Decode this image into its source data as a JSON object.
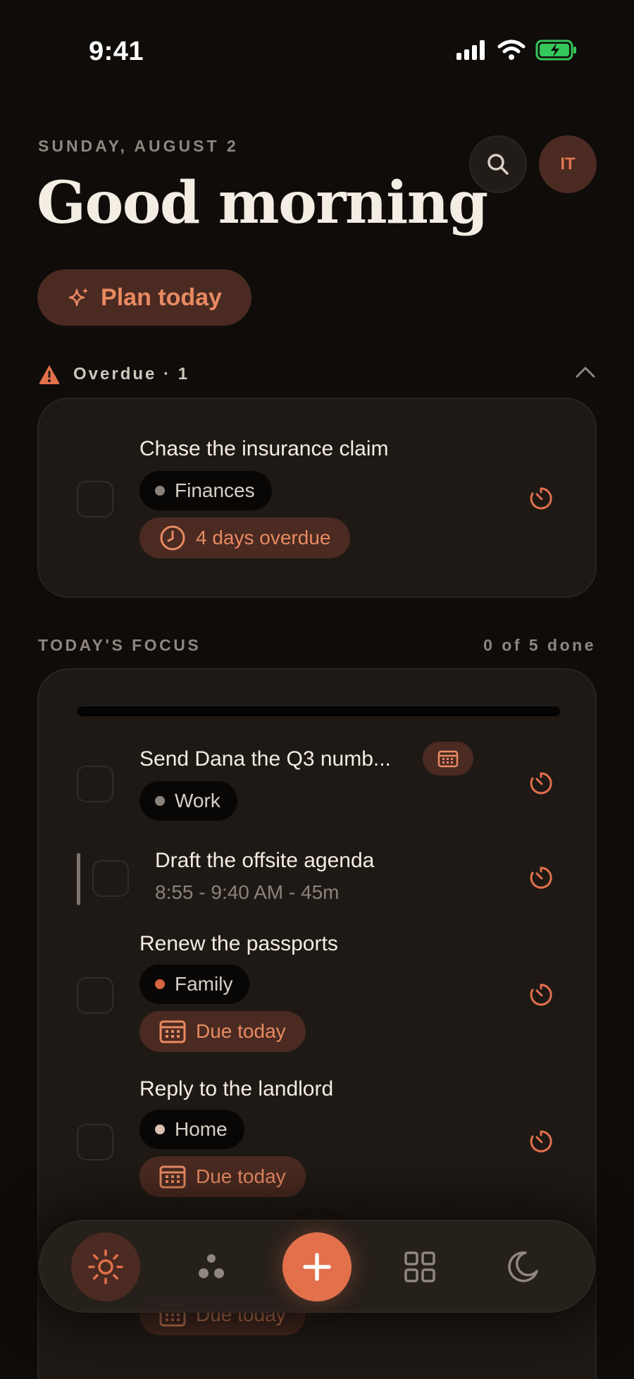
{
  "status": {
    "time": "9:41"
  },
  "header": {
    "date": "SUNDAY, AUGUST 2",
    "greeting": "Good morning",
    "avatar_initials": "IT"
  },
  "plan_button": {
    "label": "Plan today"
  },
  "overdue": {
    "label": "Overdue · 1",
    "task": {
      "title": "Chase the insurance claim",
      "tag": "Finances",
      "status": "4 days overdue"
    }
  },
  "focus": {
    "label": "TODAY'S FOCUS",
    "progress_text": "0 of 5 done",
    "progress_fraction": 0,
    "tasks": [
      {
        "title": "Send Dana the Q3 numb...",
        "tag": "Work"
      },
      {
        "title": "Draft the offsite agenda",
        "time": "8:55 - 9:40 AM  -  45m"
      },
      {
        "title": "Renew the passports",
        "tag": "Family",
        "status": "Due today"
      },
      {
        "title": "Reply to the landlord",
        "tag": "Home",
        "status": "Due today"
      },
      {
        "status": "Due today"
      }
    ]
  },
  "nav": {
    "items": [
      "today-icon",
      "clusters-icon",
      "add-icon",
      "grid-icon",
      "moon-icon"
    ]
  },
  "colors": {
    "background": "#0f0c0a",
    "card": "#1e1915",
    "accent": "#e2704b",
    "accent_bg": "#4a2a21"
  }
}
